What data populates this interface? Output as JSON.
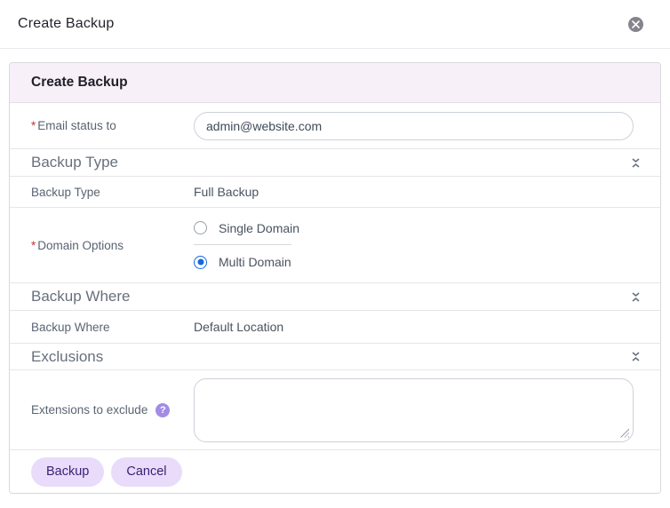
{
  "titlebar": {
    "title": "Create Backup"
  },
  "panel": {
    "header_title": "Create Backup"
  },
  "form": {
    "email": {
      "required_mark": "*",
      "label": "Email status to",
      "value": "admin@website.com"
    },
    "backup_type_section": {
      "title": "Backup Type",
      "row": {
        "label": "Backup Type",
        "value": "Full Backup"
      }
    },
    "domain_options": {
      "required_mark": "*",
      "label": "Domain Options",
      "options": [
        {
          "label": "Single Domain",
          "selected": false
        },
        {
          "label": "Multi Domain",
          "selected": true
        }
      ]
    },
    "backup_where_section": {
      "title": "Backup Where",
      "row": {
        "label": "Backup Where",
        "value": "Default Location"
      }
    },
    "exclusions_section": {
      "title": "Exclusions",
      "row": {
        "label": "Extensions to exclude",
        "textarea_value": ""
      }
    }
  },
  "footer": {
    "backup_label": "Backup",
    "cancel_label": "Cancel"
  },
  "colors": {
    "panel_header_bg": "#f7f0f8",
    "button_bg": "#e8dcfa",
    "button_text": "#3b2173",
    "radio_selected": "#1568df",
    "required_red": "#c0392b",
    "help_icon_purple": "#a38be8",
    "close_icon_gray": "#85858d"
  }
}
